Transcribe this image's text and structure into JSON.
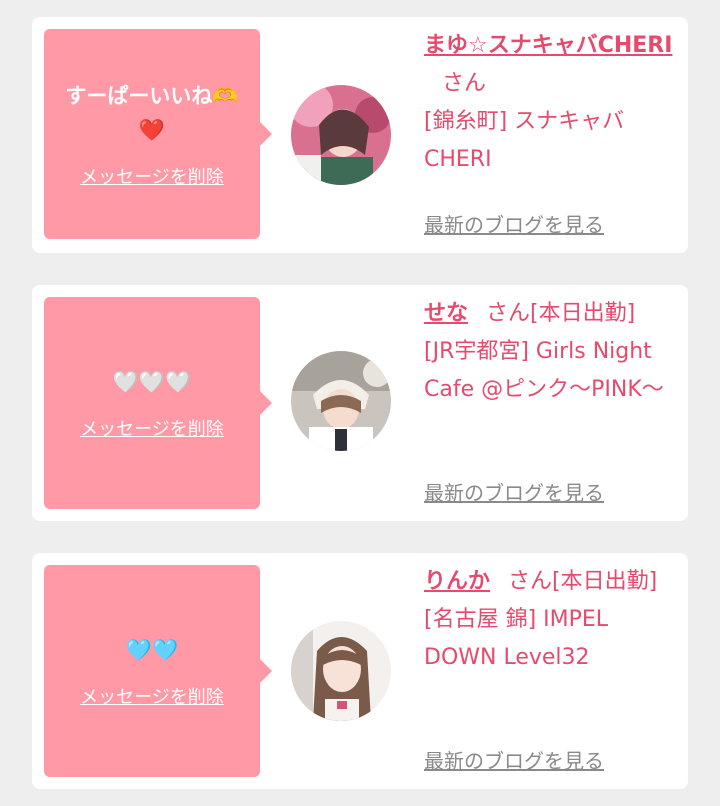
{
  "colors": {
    "accent": "#e64a6c",
    "bubble": "#ff99a6",
    "link_gray": "#8a8a8a",
    "background": "#eeeeee"
  },
  "cards": [
    {
      "message": "すーぱーいいね🫶\n❤️",
      "delete_label": "メッセージを削除",
      "name": "まゆ☆スナキャバCHERI",
      "honorific": "さん",
      "status": "",
      "shop": "[錦糸町] スナキャバCHERI",
      "blog_label": "最新のブログを見る"
    },
    {
      "message": "🤍🤍🤍",
      "delete_label": "メッセージを削除",
      "name": "せな",
      "honorific": "さん",
      "status": "[本日出勤]",
      "shop": "[JR宇都宮] Girls Night Cafe @ピンク〜PINK〜",
      "blog_label": "最新のブログを見る"
    },
    {
      "message": "🩵🩵",
      "delete_label": "メッセージを削除",
      "name": "りんか",
      "honorific": "さん",
      "status": "[本日出勤]",
      "shop": "[名古屋 錦] IMPEL DOWN Level32",
      "blog_label": "最新のブログを見る"
    }
  ]
}
